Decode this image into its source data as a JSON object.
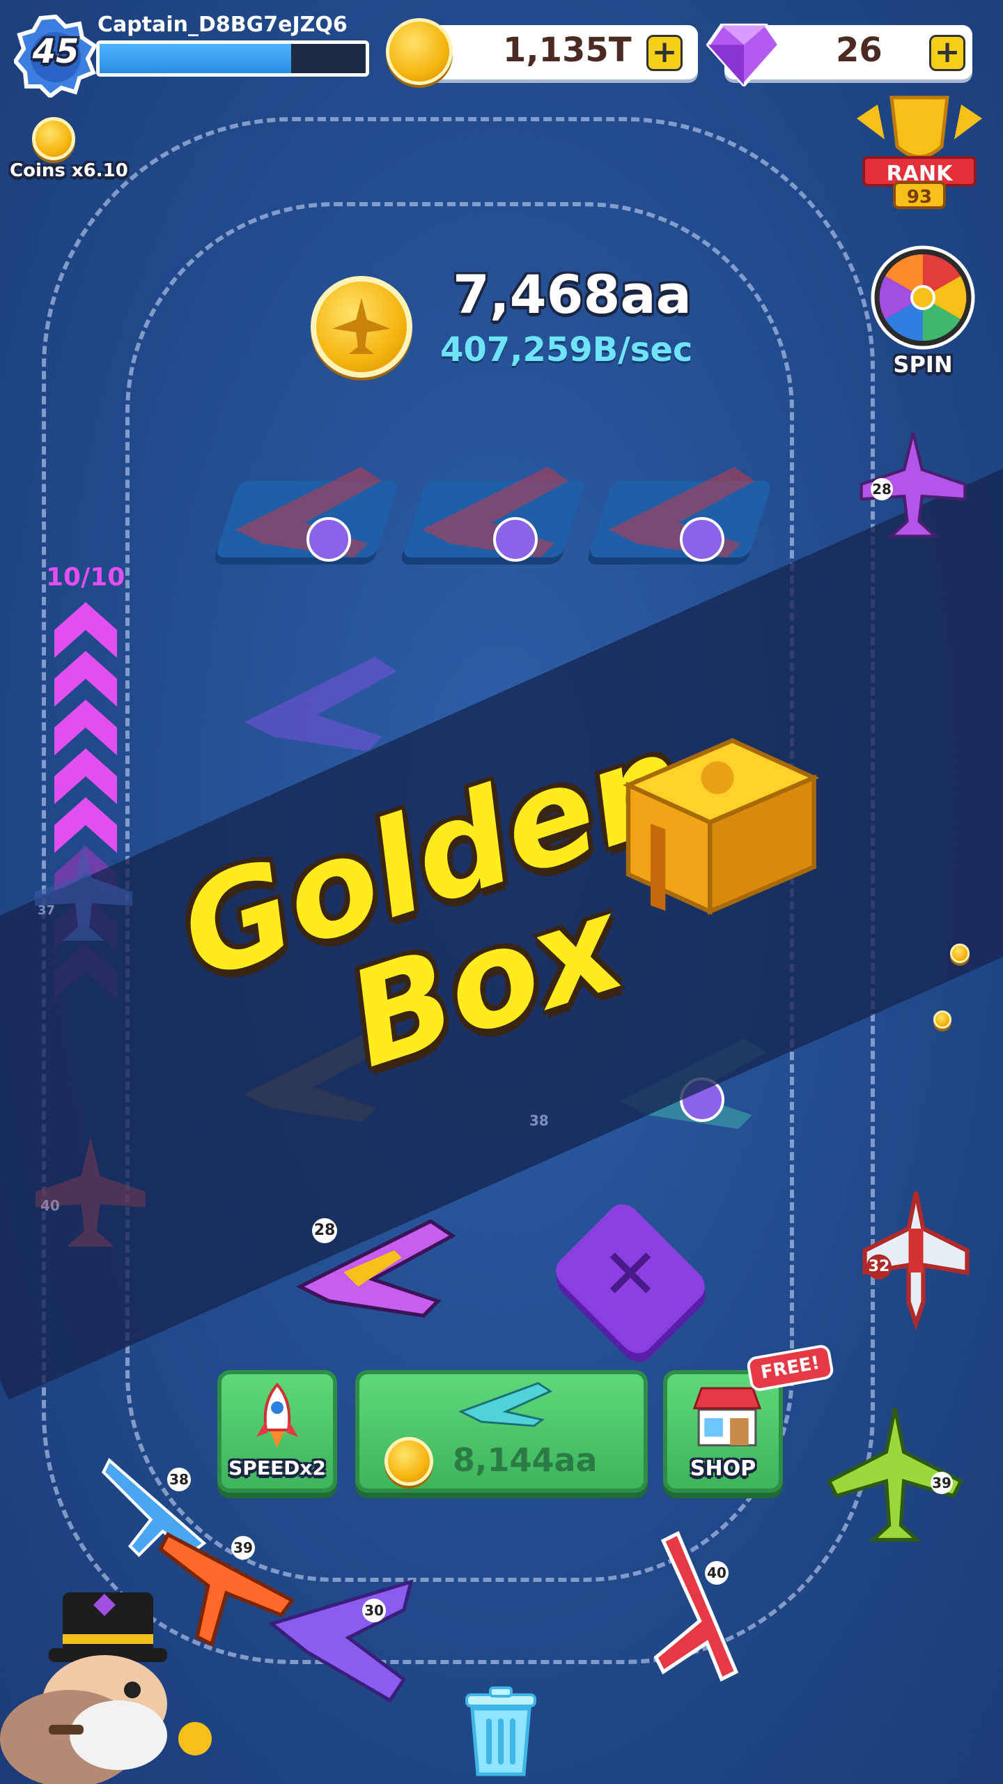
{
  "player": {
    "level": "45",
    "name": "Captain_D8BG7eJZQ6",
    "xp_progress": 0.72
  },
  "currency": {
    "coins": "1,135T",
    "gems": "26",
    "plus_label": "+"
  },
  "multiplier": {
    "label": "Coins x6.10"
  },
  "rank": {
    "label": "RANK",
    "value": "93"
  },
  "spin": {
    "label": "SPIN"
  },
  "earnings": {
    "total": "7,468aa",
    "rate": "407,259B/sec"
  },
  "boost": {
    "count": "10/10"
  },
  "banner": {
    "line1": "Golden",
    "line2": "Box"
  },
  "planes": {
    "top_right": "28",
    "mid_right": "32",
    "drag_plane": "28",
    "lower_right": "39",
    "red_bottom": "40",
    "blue_left": "38",
    "orange_left": "39",
    "purple_bottom": "30",
    "ghost_left": "37",
    "ghost_left2": "40",
    "ghost_slot": "38"
  },
  "buttons": {
    "speed": "SPEEDx2",
    "buy_price": "8,144aa",
    "shop": "SHOP",
    "shop_badge": "FREE!",
    "cancel": "✕"
  },
  "colors": {
    "background": "#224a8c",
    "accent_gold": "#f5b50f",
    "accent_cyan": "#6fe3f7",
    "boost_magenta": "#e24ff0",
    "button_green": "#4cc46a",
    "cancel_purple": "#8b3fe0"
  },
  "icons": {
    "level": "star-badge-icon",
    "coin": "coin-icon",
    "gem": "gem-icon",
    "rank": "trophy-icon",
    "spin": "wheel-icon",
    "speed": "rocket-icon",
    "shop": "store-icon",
    "trash": "trash-icon",
    "return": "return-arrow-icon"
  }
}
